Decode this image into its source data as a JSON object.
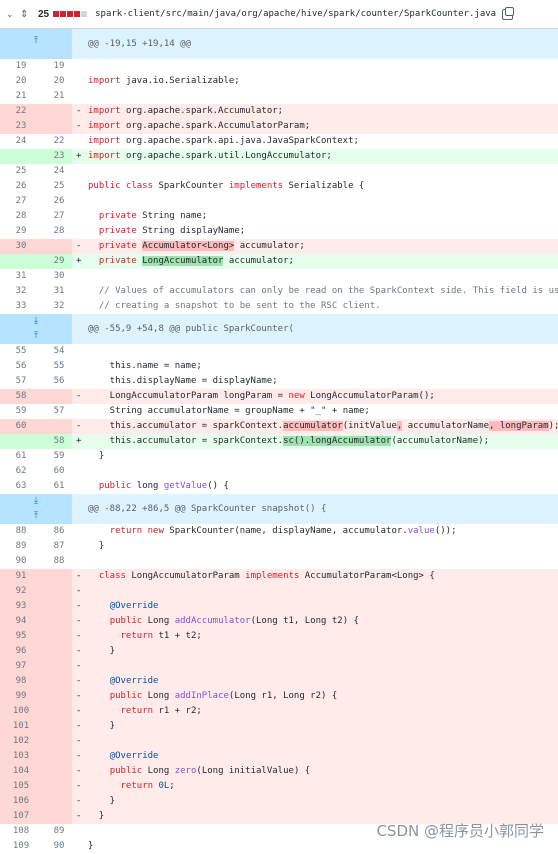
{
  "file": {
    "changes": "25",
    "path": "spark-client/src/main/java/org/apache/hive/spark/counter/SparkCounter.java",
    "diffstat_colors": [
      "#cf222e",
      "#cf222e",
      "#cf222e",
      "#cf222e",
      "#d0d7de"
    ]
  },
  "watermark": "CSDN @程序员小郭同学",
  "rows": [
    {
      "type": "hunk",
      "text": "@@ -19,15 +19,14 @@",
      "icon": "up"
    },
    {
      "type": "ctx",
      "l": "19",
      "r": "19",
      "segs": []
    },
    {
      "type": "ctx",
      "l": "20",
      "r": "20",
      "segs": [
        [
          "kw",
          "import"
        ],
        [
          "",
          "java.io.Serializable;"
        ]
      ]
    },
    {
      "type": "ctx",
      "l": "21",
      "r": "21",
      "segs": []
    },
    {
      "type": "del",
      "l": "22",
      "r": "",
      "segs": [
        [
          "kw",
          "import"
        ],
        [
          "",
          "org.apache.spark.Accumulator;"
        ]
      ]
    },
    {
      "type": "del",
      "l": "23",
      "r": "",
      "segs": [
        [
          "kw",
          "import"
        ],
        [
          "",
          "org.apache.spark.AccumulatorParam;"
        ]
      ]
    },
    {
      "type": "ctx",
      "l": "24",
      "r": "22",
      "segs": [
        [
          "kw",
          "import"
        ],
        [
          "",
          "org.apache.spark.api.java.JavaSparkContext;"
        ]
      ]
    },
    {
      "type": "add",
      "l": "",
      "r": "23",
      "segs": [
        [
          "kw",
          "import"
        ],
        [
          "",
          "org.apache.spark.util.LongAccumulator;"
        ]
      ]
    },
    {
      "type": "ctx",
      "l": "25",
      "r": "24",
      "segs": []
    },
    {
      "type": "ctx",
      "l": "26",
      "r": "25",
      "segs": [
        [
          "kw",
          "public class"
        ],
        [
          "",
          " SparkCounter "
        ],
        [
          "kw",
          "implements"
        ],
        [
          "",
          " Serializable {"
        ]
      ]
    },
    {
      "type": "ctx",
      "l": "27",
      "r": "26",
      "segs": []
    },
    {
      "type": "ctx",
      "l": "28",
      "r": "27",
      "segs": [
        [
          "",
          "  "
        ],
        [
          "kw",
          "private"
        ],
        [
          "",
          " String name;"
        ]
      ]
    },
    {
      "type": "ctx",
      "l": "29",
      "r": "28",
      "segs": [
        [
          "",
          "  "
        ],
        [
          "kw",
          "private"
        ],
        [
          "",
          " String displayName;"
        ]
      ]
    },
    {
      "type": "del",
      "l": "30",
      "r": "",
      "segs": [
        [
          "",
          "  "
        ],
        [
          "kw",
          "private"
        ],
        [
          "",
          " "
        ],
        [
          "hl-del",
          "Accumulator<Long>"
        ],
        [
          "",
          " accumulator;"
        ]
      ]
    },
    {
      "type": "add",
      "l": "",
      "r": "29",
      "segs": [
        [
          "",
          "  "
        ],
        [
          "kw",
          "private"
        ],
        [
          "",
          " "
        ],
        [
          "hl-add",
          "LongAccumulator"
        ],
        [
          "",
          " accumulator;"
        ]
      ]
    },
    {
      "type": "ctx",
      "l": "31",
      "r": "30",
      "segs": []
    },
    {
      "type": "ctx",
      "l": "32",
      "r": "31",
      "segs": [
        [
          "cm",
          "  // Values of accumulators can only be read on the SparkContext side. This field is used when"
        ]
      ]
    },
    {
      "type": "ctx",
      "l": "33",
      "r": "32",
      "segs": [
        [
          "cm",
          "  // creating a snapshot to be sent to the RSC client."
        ]
      ]
    },
    {
      "type": "hunk",
      "text": "@@ -55,9 +54,8 @@ public SparkCounter(",
      "icon": "both"
    },
    {
      "type": "ctx",
      "l": "55",
      "r": "54",
      "segs": []
    },
    {
      "type": "ctx",
      "l": "56",
      "r": "55",
      "segs": [
        [
          "",
          "    this.name = name;"
        ]
      ]
    },
    {
      "type": "ctx",
      "l": "57",
      "r": "56",
      "segs": [
        [
          "",
          "    this.displayName = displayName;"
        ]
      ]
    },
    {
      "type": "del",
      "l": "58",
      "r": "",
      "segs": [
        [
          "",
          "    LongAccumulatorParam longParam = "
        ],
        [
          "kw",
          "new"
        ],
        [
          "",
          " LongAccumulatorParam();"
        ]
      ]
    },
    {
      "type": "ctx",
      "l": "59",
      "r": "57",
      "segs": [
        [
          "",
          "    String accumulatorName = groupName + "
        ],
        [
          "st",
          "\"_\""
        ],
        [
          "",
          " + name;"
        ]
      ]
    },
    {
      "type": "del",
      "l": "60",
      "r": "",
      "segs": [
        [
          "",
          "    this.accumulator = sparkContext."
        ],
        [
          "hl-del",
          "accumulator"
        ],
        [
          "",
          "(initValue"
        ],
        [
          "hl-del",
          ","
        ],
        [
          "",
          " accumulatorName"
        ],
        [
          "hl-del",
          ", longParam"
        ],
        [
          "",
          ");"
        ]
      ]
    },
    {
      "type": "add",
      "l": "",
      "r": "58",
      "segs": [
        [
          "",
          "    this.accumulator = sparkContext."
        ],
        [
          "hl-add",
          "sc().longAccumulator"
        ],
        [
          "",
          "(accumulatorName);"
        ]
      ]
    },
    {
      "type": "ctx",
      "l": "61",
      "r": "59",
      "segs": [
        [
          "",
          "  }"
        ]
      ]
    },
    {
      "type": "ctx",
      "l": "62",
      "r": "60",
      "segs": []
    },
    {
      "type": "ctx",
      "l": "63",
      "r": "61",
      "segs": [
        [
          "",
          "  "
        ],
        [
          "kw",
          "public"
        ],
        [
          "",
          " long "
        ],
        [
          "fn",
          "getValue"
        ],
        [
          "",
          "() {"
        ]
      ]
    },
    {
      "type": "hunk",
      "text": "@@ -88,22 +86,5 @@ SparkCounter snapshot() {",
      "icon": "both"
    },
    {
      "type": "ctx",
      "l": "88",
      "r": "86",
      "segs": [
        [
          "",
          "    "
        ],
        [
          "kw",
          "return new"
        ],
        [
          "",
          " SparkCounter(name, displayName, accumulator."
        ],
        [
          "fn",
          "value"
        ],
        [
          "",
          "());"
        ]
      ]
    },
    {
      "type": "ctx",
      "l": "89",
      "r": "87",
      "segs": [
        [
          "",
          "  }"
        ]
      ]
    },
    {
      "type": "ctx",
      "l": "90",
      "r": "88",
      "segs": []
    },
    {
      "type": "del",
      "l": "91",
      "r": "",
      "segs": [
        [
          "",
          "  "
        ],
        [
          "kw",
          "class"
        ],
        [
          "",
          " LongAccumulatorParam "
        ],
        [
          "kw",
          "implements"
        ],
        [
          "",
          " AccumulatorParam<Long> {"
        ]
      ]
    },
    {
      "type": "del",
      "l": "92",
      "r": "",
      "segs": []
    },
    {
      "type": "del",
      "l": "93",
      "r": "",
      "segs": [
        [
          "",
          "    "
        ],
        [
          "nm",
          "@Override"
        ]
      ]
    },
    {
      "type": "del",
      "l": "94",
      "r": "",
      "segs": [
        [
          "",
          "    "
        ],
        [
          "kw",
          "public"
        ],
        [
          "",
          " Long "
        ],
        [
          "fn",
          "addAccumulator"
        ],
        [
          "",
          "(Long t1, Long t2) {"
        ]
      ]
    },
    {
      "type": "del",
      "l": "95",
      "r": "",
      "segs": [
        [
          "",
          "      "
        ],
        [
          "kw",
          "return"
        ],
        [
          "",
          " t1 + t2;"
        ]
      ]
    },
    {
      "type": "del",
      "l": "96",
      "r": "",
      "segs": [
        [
          "",
          "    }"
        ]
      ]
    },
    {
      "type": "del",
      "l": "97",
      "r": "",
      "segs": []
    },
    {
      "type": "del",
      "l": "98",
      "r": "",
      "segs": [
        [
          "",
          "    "
        ],
        [
          "nm",
          "@Override"
        ]
      ]
    },
    {
      "type": "del",
      "l": "99",
      "r": "",
      "segs": [
        [
          "",
          "    "
        ],
        [
          "kw",
          "public"
        ],
        [
          "",
          " Long "
        ],
        [
          "fn",
          "addInPlace"
        ],
        [
          "",
          "(Long r1, Long r2) {"
        ]
      ]
    },
    {
      "type": "del",
      "l": "100",
      "r": "",
      "segs": [
        [
          "",
          "      "
        ],
        [
          "kw",
          "return"
        ],
        [
          "",
          " r1 + r2;"
        ]
      ]
    },
    {
      "type": "del",
      "l": "101",
      "r": "",
      "segs": [
        [
          "",
          "    }"
        ]
      ]
    },
    {
      "type": "del",
      "l": "102",
      "r": "",
      "segs": []
    },
    {
      "type": "del",
      "l": "103",
      "r": "",
      "segs": [
        [
          "",
          "    "
        ],
        [
          "nm",
          "@Override"
        ]
      ]
    },
    {
      "type": "del",
      "l": "104",
      "r": "",
      "segs": [
        [
          "",
          "    "
        ],
        [
          "kw",
          "public"
        ],
        [
          "",
          " Long "
        ],
        [
          "fn",
          "zero"
        ],
        [
          "",
          "(Long initialValue) {"
        ]
      ]
    },
    {
      "type": "del",
      "l": "105",
      "r": "",
      "segs": [
        [
          "",
          "      "
        ],
        [
          "kw",
          "return"
        ],
        [
          "",
          " "
        ],
        [
          "nm",
          "0L"
        ],
        [
          ";"
        ]
      ]
    },
    {
      "type": "del",
      "l": "106",
      "r": "",
      "segs": [
        [
          "",
          "    }"
        ]
      ]
    },
    {
      "type": "del",
      "l": "107",
      "r": "",
      "segs": [
        [
          "",
          "  }"
        ]
      ]
    },
    {
      "type": "ctx",
      "l": "108",
      "r": "89",
      "segs": []
    },
    {
      "type": "ctx",
      "l": "109",
      "r": "90",
      "segs": [
        [
          "",
          "}"
        ]
      ]
    }
  ]
}
